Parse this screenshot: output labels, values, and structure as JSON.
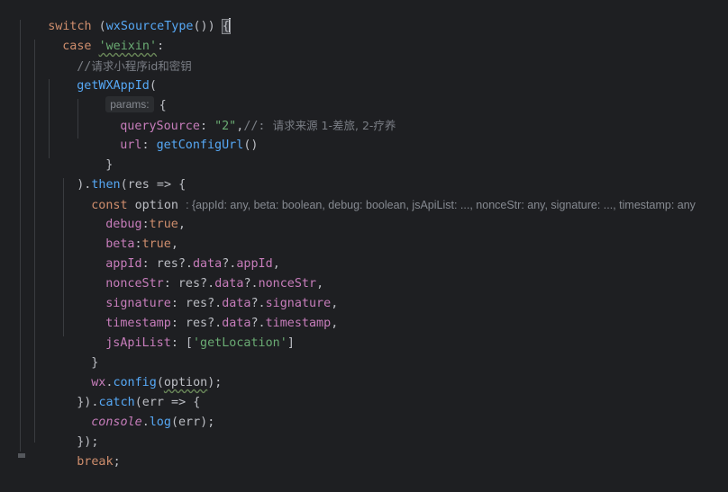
{
  "editor": {
    "line_switch": {
      "kw": "switch",
      "open_paren": " (",
      "call": "wxSourceType",
      "rest": "()) ",
      "brace": "{"
    },
    "line_case": {
      "kw": "case",
      "space": " ",
      "str": "'weixin'",
      "colon": ":"
    },
    "line_comment": {
      "slashes": "//",
      "text": "请求小程序id和密钥"
    },
    "line_getwx": {
      "fn": "getWXAppId",
      "paren": "("
    },
    "line_params": {
      "hint": "params:",
      "brace": "{"
    },
    "line_query": {
      "prop": "querySource",
      "colon": ": ",
      "str": "\"2\"",
      "comma": ",",
      "comment_slashes": "//: ",
      "comment_text": "请求来源 1-差旅, 2-疗养"
    },
    "line_url": {
      "prop": "url",
      "colon": ": ",
      "fn": "getConfigUrl",
      "paren": "()"
    },
    "line_close1": {
      "text": "}"
    },
    "line_then": {
      "pre": ").",
      "fn": "then",
      "rest": "(res => {"
    },
    "line_const": {
      "kw": "const",
      "name": " option ",
      "type_hint": ": {appId: any, beta: boolean, debug: boolean, jsApiList: ..., nonceStr: any, signature: ..., timestamp: any"
    },
    "line_debug": {
      "prop": "debug",
      "colon": ":",
      "val": "true",
      "comma": ","
    },
    "line_beta": {
      "prop": "beta",
      "colon": ":",
      "val": "true",
      "comma": ","
    },
    "line_appid": {
      "prop": "appId",
      "mid": ": res?.",
      "p1": "data",
      "q": "?.",
      "p2": "appId",
      "end": ","
    },
    "line_nonce": {
      "prop": "nonceStr",
      "mid": ": res?.",
      "p1": "data",
      "q": "?.",
      "p2": "nonceStr",
      "end": ","
    },
    "line_sig": {
      "prop": "signature",
      "mid": ": res?.",
      "p1": "data",
      "q": "?.",
      "p2": "signature",
      "end": ","
    },
    "line_ts": {
      "prop": "timestamp",
      "mid": ": res?.",
      "p1": "data",
      "q": "?.",
      "p2": "timestamp",
      "end": ","
    },
    "line_jsapi": {
      "prop": "jsApiList",
      "mid": ": [",
      "str": "'getLocation'",
      "end": "]"
    },
    "line_close2": {
      "text": "}"
    },
    "line_wxconfig": {
      "obj": "wx",
      "dot": ".",
      "fn": "config",
      "open": "(",
      "arg": "option",
      "close": ");"
    },
    "line_catch": {
      "pre": "}).",
      "fn": "catch",
      "rest": "(err => {"
    },
    "line_console": {
      "obj": "console",
      "dot": ".",
      "fn": "log",
      "rest": "(err);"
    },
    "line_close3": {
      "text": "});"
    },
    "line_break": {
      "kw": "break",
      "semi": ";"
    }
  },
  "colors": {
    "background": "#1e1f22",
    "keyword": "#cf8e6d",
    "function": "#56a8f5",
    "string": "#6aab73",
    "property": "#c77dbb",
    "comment": "#7a7e85",
    "default": "#bcbec4"
  }
}
